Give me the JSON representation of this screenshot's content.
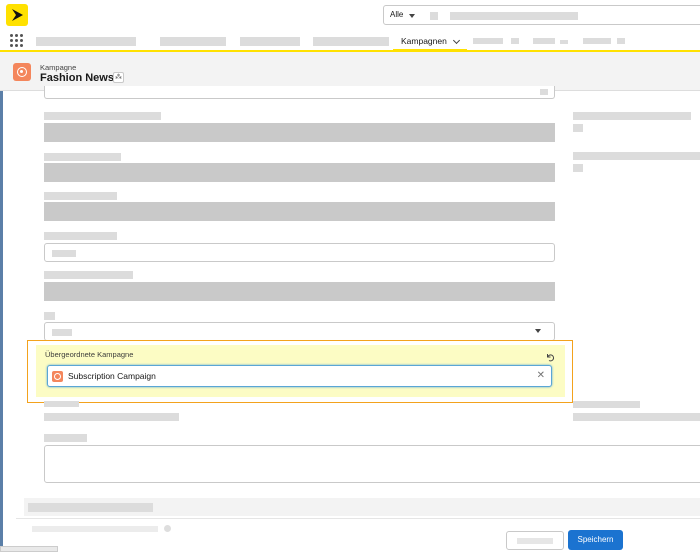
{
  "header": {
    "search_scope": "Alle",
    "active_tab": "Kampagnen"
  },
  "record": {
    "object_type": "Kampagne",
    "name": "Fashion News"
  },
  "form": {
    "parent_campaign_label": "Übergeordnete Kampagne",
    "parent_campaign_value": "Subscription Campaign"
  },
  "footer": {
    "save_label": "Speichern"
  },
  "colors": {
    "brand_yellow": "#ffe100",
    "campaign_orange": "#f4865c",
    "primary_blue": "#1b73d0",
    "highlight_border": "#f3a21d",
    "highlight_fill": "#fcfcc4"
  }
}
